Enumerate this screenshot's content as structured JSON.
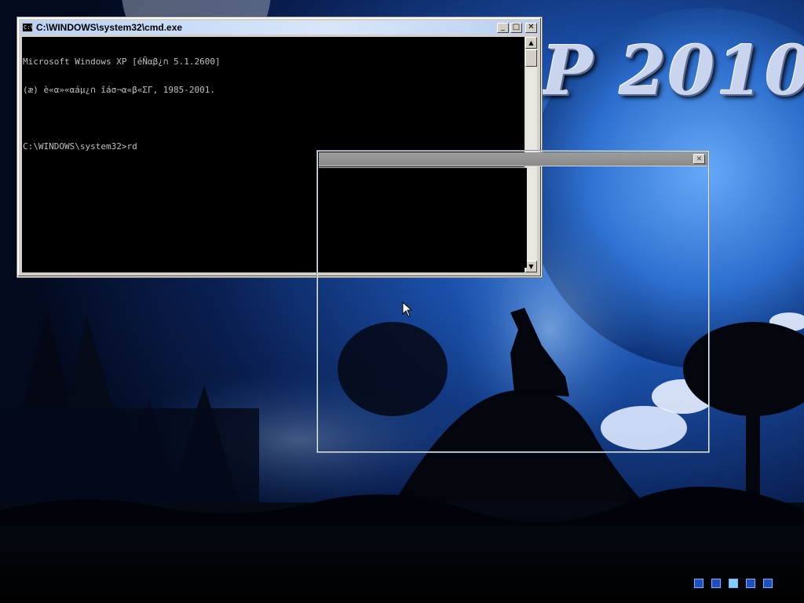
{
  "wallpaper": {
    "brand_text": "P 2010"
  },
  "cmd_window": {
    "title": "C:\\WINDOWS\\system32\\cmd.exe",
    "icon_label": "C:\\",
    "lines": [
      "Microsoft Windows XP [éÑαβ¿∩ 5.1.2600]",
      "(æ) è«α»«αáµ¿∩ îáσ¬α«β«ΣΓ, 1985-2001.",
      "",
      "C:\\WINDOWS\\system32>rd"
    ],
    "buttons": {
      "minimize": "_",
      "maximize": "□",
      "close": "✕"
    },
    "scroll": {
      "up": "▲",
      "down": "▼"
    }
  },
  "ghost_window": {
    "close": "✕"
  },
  "tray": {
    "blocks": [
      {
        "color": "#1f4fbf"
      },
      {
        "color": "#1f4fbf"
      },
      {
        "color": "#7fd0ff"
      },
      {
        "color": "#1f4fbf"
      },
      {
        "color": "#1f4fbf"
      }
    ]
  }
}
